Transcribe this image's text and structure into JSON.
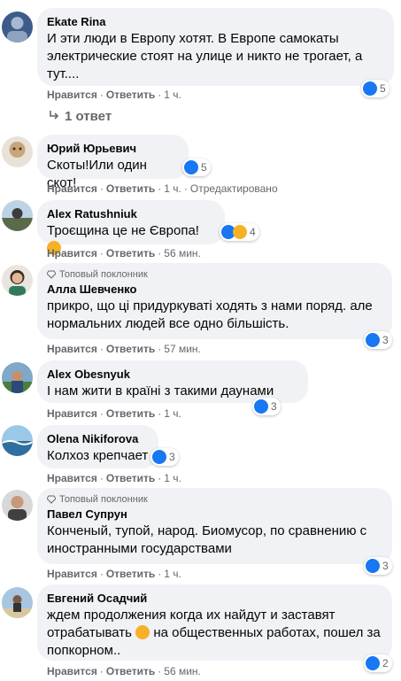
{
  "comments": [
    {
      "author": "Ekate Rina",
      "badge": "",
      "text": "И эти люди в Европу хотят. В Европе самокаты электрические стоят на улице и никто не трогает, а тут....",
      "like": "Нравится",
      "reply": "Ответить",
      "time": "1 ч.",
      "edited": "",
      "reaction_count": "5"
    },
    {
      "author": "Юрий Юрьевич",
      "badge": "",
      "text": "Скоты!Или один скот!",
      "like": "Нравится",
      "reply": "Ответить",
      "time": "1 ч.",
      "edited": "Отредактировано",
      "reaction_count": "5"
    },
    {
      "author": "Alex Ratushniuk",
      "badge": "",
      "text": "Троєщина це не Європа!",
      "like": "Нравится",
      "reply": "Ответить",
      "time": "56 мин.",
      "edited": "",
      "reaction_count": "4"
    },
    {
      "author": "Алла Шевченко",
      "badge": "Топовый поклонник",
      "text": "прикро, що ці придуркуваті ходять з нами поряд. але нормальних людей все одно більшість.",
      "like": "Нравится",
      "reply": "Ответить",
      "time": "57 мин.",
      "edited": "",
      "reaction_count": "3"
    },
    {
      "author": "Alex Obesnyuk",
      "badge": "",
      "text": "І нам жити в країні з такими даунами",
      "like": "Нравится",
      "reply": "Ответить",
      "time": "1 ч.",
      "edited": "",
      "reaction_count": "3"
    },
    {
      "author": "Olena Nikiforova",
      "badge": "",
      "text": "Колхоз крепчает",
      "like": "Нравится",
      "reply": "Ответить",
      "time": "1 ч.",
      "edited": "",
      "reaction_count": "3"
    },
    {
      "author": "Павел Супрун",
      "badge": "Топовый поклонник",
      "text": "Конченый, тупой, народ. Биомусор, по сравнению с иностранными государствами",
      "like": "Нравится",
      "reply": "Ответить",
      "time": "1 ч.",
      "edited": "",
      "reaction_count": "3"
    },
    {
      "author": "Евгений Осадчий",
      "badge": "",
      "text_before_emoji": "ждем продолжения когда их найдут и заставят отрабатывать",
      "text_after_emoji": "на общественных работах, пошел за попкорном..",
      "like": "Нравится",
      "reply": "Ответить",
      "time": "56 мин.",
      "edited": "",
      "reaction_count": "2"
    }
  ],
  "replies_link": "1 ответ",
  "separator": "·",
  "colors": {
    "bubble": "#f0f2f5",
    "meta_text": "#65676b",
    "like_blue": "#1877f2",
    "haha_yellow": "#f7b125"
  }
}
